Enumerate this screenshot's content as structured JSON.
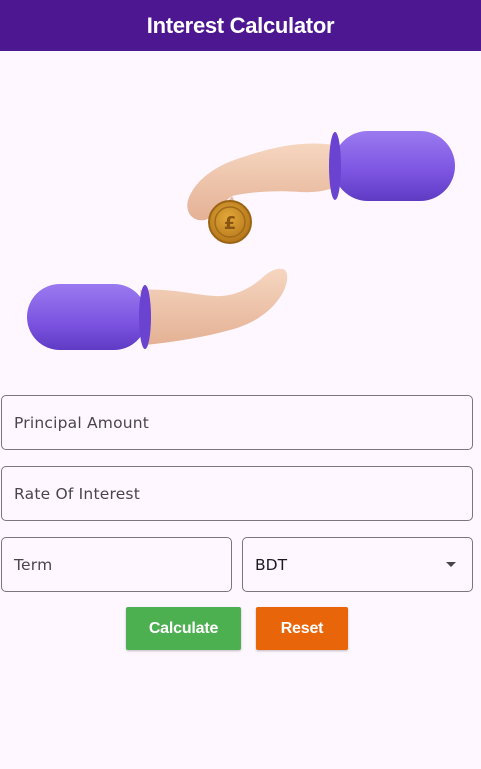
{
  "app_bar": {
    "title": "Interest Calculator",
    "background": "#4e1792"
  },
  "illustration": {
    "icon": "hands-exchanging-pound-coin-illustration"
  },
  "form": {
    "principal": {
      "label": "Principal Amount"
    },
    "rate": {
      "label": "Rate Of Interest"
    },
    "term": {
      "label": "Term"
    },
    "currency": {
      "selected": "BDT"
    }
  },
  "buttons": {
    "calculate": {
      "label": "Calculate",
      "color": "#4caf50"
    },
    "reset": {
      "label": "Reset",
      "color": "#e8650a"
    }
  }
}
